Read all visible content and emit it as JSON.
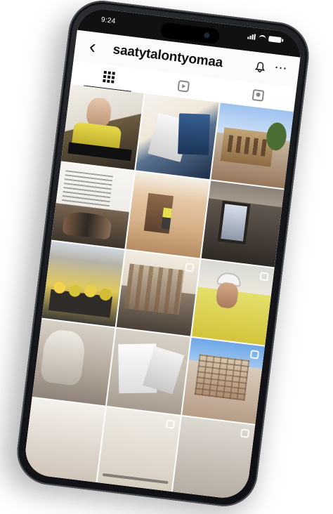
{
  "status_bar": {
    "time": "9:24"
  },
  "header": {
    "profile_name": "saatytalontyomaa",
    "back_icon": "chevron-left-icon",
    "bell_icon": "bell-icon",
    "more_icon": "more-icon"
  },
  "tabs": [
    {
      "name": "grid",
      "icon": "grid-icon"
    },
    {
      "name": "reels",
      "icon": "reels-icon"
    },
    {
      "name": "tagged",
      "icon": "tagged-icon"
    }
  ],
  "colors": {
    "background": "#ffffff",
    "phone_body": "#15171a",
    "ui_text": "#111111"
  }
}
